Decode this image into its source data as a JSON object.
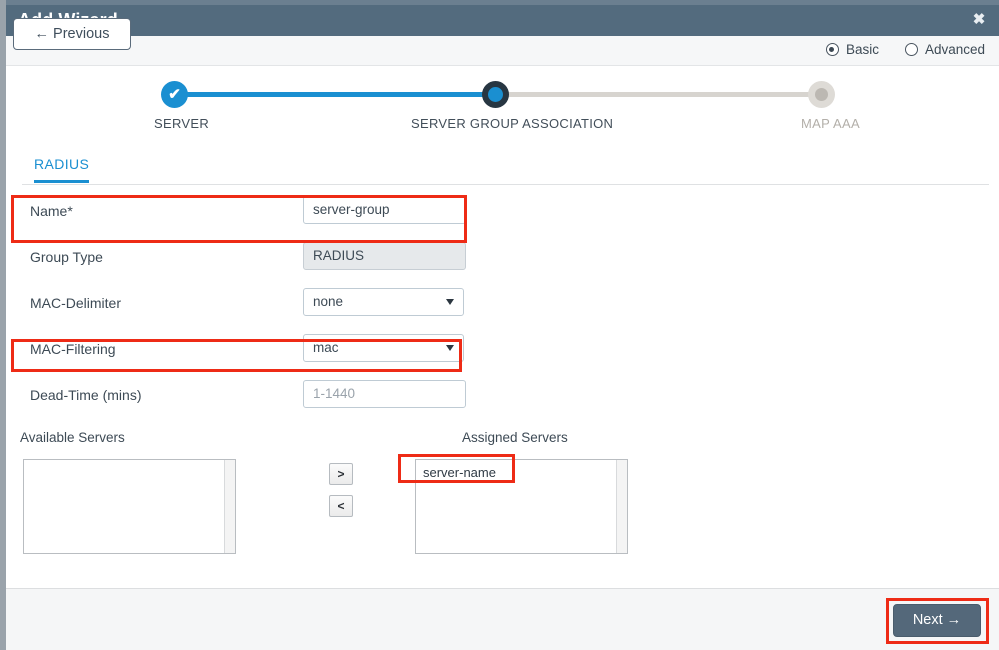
{
  "window": {
    "title": "Add Wizard",
    "close_icon": "close-icon",
    "close_glyph": "✖"
  },
  "mode": {
    "options": [
      {
        "label": "Basic",
        "selected": true
      },
      {
        "label": "Advanced",
        "selected": false
      }
    ]
  },
  "stepper": {
    "steps": [
      {
        "label": "SERVER",
        "state": "done",
        "glyph": "✔"
      },
      {
        "label": "SERVER GROUP ASSOCIATION",
        "state": "current"
      },
      {
        "label": "MAP AAA",
        "state": "todo"
      }
    ],
    "colors": {
      "done": "#1a8fd1",
      "current_ring": "#273642",
      "todo": "#dedbd6"
    }
  },
  "tabs": [
    {
      "label": "RADIUS",
      "active": true
    }
  ],
  "form": {
    "rows": [
      {
        "label": "Name*",
        "type": "text",
        "value": "server-group",
        "placeholder": "",
        "readonly": false,
        "highlighted": true
      },
      {
        "label": "Group Type",
        "type": "text",
        "value": "RADIUS",
        "placeholder": "",
        "readonly": true,
        "highlighted": false
      },
      {
        "label": "MAC-Delimiter",
        "type": "select",
        "value": "none",
        "placeholder": "",
        "readonly": false,
        "highlighted": false
      },
      {
        "label": "MAC-Filtering",
        "type": "select",
        "value": "mac",
        "placeholder": "",
        "readonly": false,
        "highlighted": true
      },
      {
        "label": "Dead-Time (mins)",
        "type": "text",
        "value": "",
        "placeholder": "1-1440",
        "readonly": false,
        "highlighted": false
      }
    ]
  },
  "dual_list": {
    "available_heading": "Available Servers",
    "assigned_heading": "Assigned Servers",
    "available_items": [],
    "assigned_items": [
      "server-name"
    ],
    "move_right_label": ">",
    "move_left_label": "<"
  },
  "footer": {
    "previous_label": "Previous",
    "previous_arrow": "←",
    "next_label": "Next",
    "next_arrow": "→"
  },
  "annotations": {
    "highlight_color": "#ee2b16",
    "boxes": [
      "name-field-row",
      "mac-filtering-row",
      "assigned-server-item",
      "next-button"
    ]
  }
}
